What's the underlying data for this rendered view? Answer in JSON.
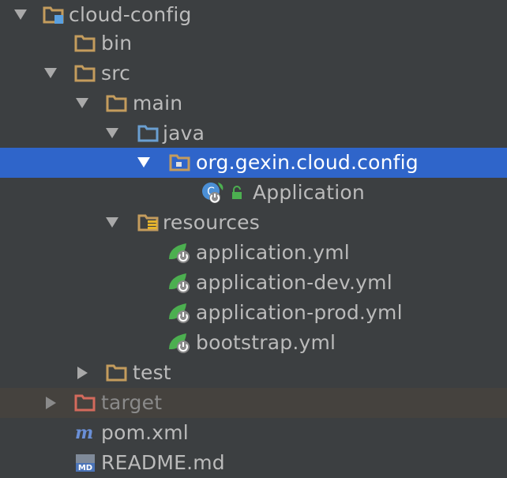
{
  "tree": {
    "root": {
      "label": "cloud-config"
    },
    "bin": {
      "label": "bin"
    },
    "src": {
      "label": "src"
    },
    "main": {
      "label": "main"
    },
    "java": {
      "label": "java"
    },
    "package": {
      "label": "org.gexin.cloud.config"
    },
    "application_class": {
      "label": "Application"
    },
    "resources": {
      "label": "resources"
    },
    "files": [
      {
        "label": "application.yml"
      },
      {
        "label": "application-dev.yml"
      },
      {
        "label": "application-prod.yml"
      },
      {
        "label": "bootstrap.yml"
      }
    ],
    "test": {
      "label": "test"
    },
    "target": {
      "label": "target"
    },
    "pom": {
      "label": "pom.xml",
      "badge": "m"
    },
    "readme": {
      "label": "README.md",
      "badge": "MD"
    }
  },
  "colors": {
    "background": "#3c3f41",
    "selection": "#2f65ca",
    "excluded_row": "#45423e",
    "folder": "#c49c5d",
    "source_folder": "#6a9fd1",
    "excluded_folder": "#d46a5c",
    "spring_leaf": "#4caf50"
  }
}
